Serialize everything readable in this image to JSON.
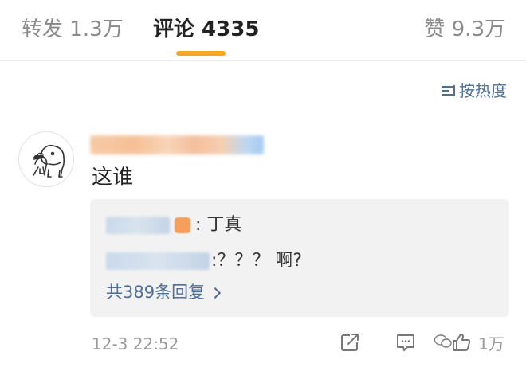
{
  "tabs": {
    "repost": "转发 1.3万",
    "comments": "评论 4335",
    "likes": "赞 9.3万"
  },
  "sort": {
    "label": "按热度"
  },
  "comment": {
    "text": "这谁",
    "timestamp": "12-3 22:52",
    "like_count": "1万",
    "replies": [
      {
        "text": ": 丁真"
      },
      {
        "text": ":？？？ 啊?"
      }
    ],
    "more_replies": "共389条回复"
  },
  "colors": {
    "accent": "#f5a623",
    "link": "#4e6f99",
    "reply_bg": "#f2f2f2"
  },
  "icons": [
    "sort-icon",
    "avatar",
    "share-icon",
    "comment-icon",
    "like-icon",
    "chevron-right-icon",
    "wechat-icon"
  ]
}
